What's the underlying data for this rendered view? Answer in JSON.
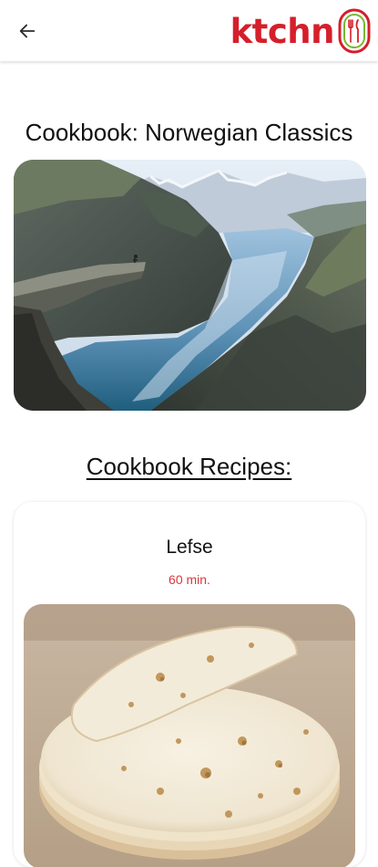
{
  "header": {
    "back_icon": "arrow-left-icon",
    "brand": "ktchn",
    "brand_color": "#d51f2b",
    "badge_icon": "fork-knife-icon"
  },
  "cookbook": {
    "title": "Cookbook: Norwegian Classics",
    "cover_image": "norwegian-fjord-photo"
  },
  "recipes_section": {
    "heading": "Cookbook Recipes:"
  },
  "recipes": [
    {
      "name": "Lefse",
      "time": "60 min.",
      "time_color": "#d6383a",
      "image": "lefse-flatbread-photo"
    }
  ]
}
